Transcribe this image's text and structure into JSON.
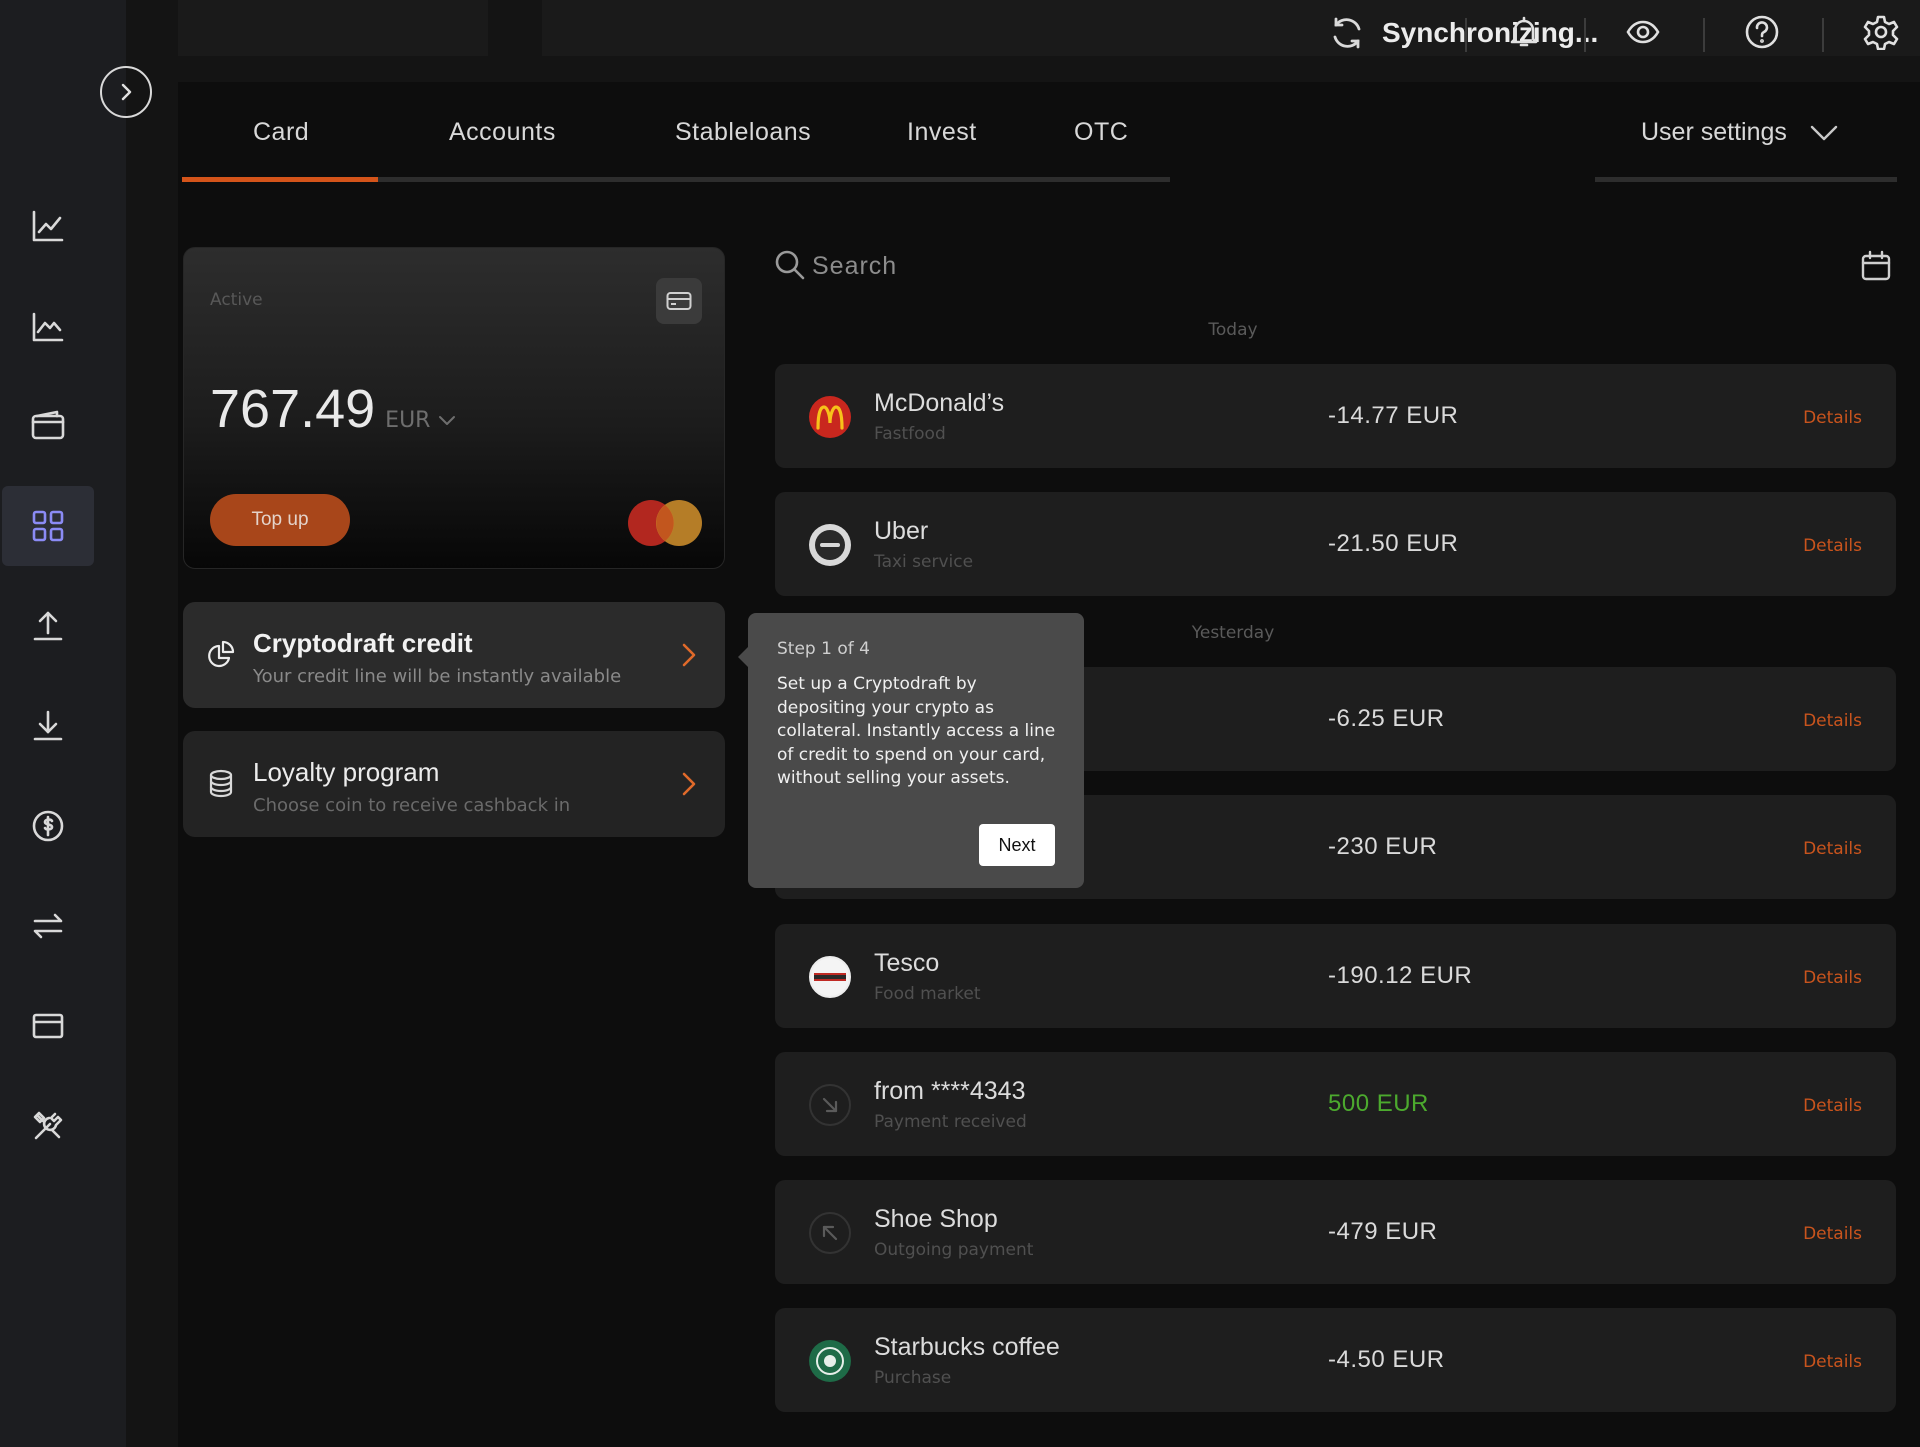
{
  "header": {
    "sync_status": "Synchronizing..."
  },
  "tabs": [
    {
      "label": "Card"
    },
    {
      "label": "Accounts"
    },
    {
      "label": "Stableloans"
    },
    {
      "label": "Invest"
    },
    {
      "label": "OTC"
    }
  ],
  "user_settings": {
    "label": "User settings"
  },
  "card": {
    "status": "Active",
    "balance": "767.49",
    "currency": "EUR",
    "topup_label": "Top up"
  },
  "features": [
    {
      "title": "Cryptodraft credit",
      "subtitle": "Your credit line will be instantly available"
    },
    {
      "title": "Loyalty program",
      "subtitle": "Choose coin to receive cashback in"
    }
  ],
  "search": {
    "placeholder": "Search"
  },
  "groups": {
    "today": "Today",
    "yesterday": "Yesterday"
  },
  "transactions": [
    {
      "name": "McDonald’s",
      "category": "Fastfood",
      "amount": "-14.77 EUR",
      "details": "Details"
    },
    {
      "name": "Uber",
      "category": "Taxi service",
      "amount": "-21.50 EUR",
      "details": "Details"
    },
    {
      "name": "",
      "category": "",
      "amount": "-6.25 EUR",
      "details": "Details"
    },
    {
      "name": "",
      "category": "",
      "amount": "-230 EUR",
      "details": "Details"
    },
    {
      "name": "Tesco",
      "category": "Food market",
      "amount": "-190.12 EUR",
      "details": "Details"
    },
    {
      "name": "from ****4343",
      "category": "Payment received",
      "amount": "500 EUR",
      "details": "Details"
    },
    {
      "name": "Shoe Shop",
      "category": "Outgoing payment",
      "amount": "-479 EUR",
      "details": "Details"
    },
    {
      "name": "Starbucks coffee",
      "category": "Purchase",
      "amount": "-4.50 EUR",
      "details": "Details"
    }
  ],
  "tooltip": {
    "step": "Step 1 of 4",
    "body": "Set up a Cryptodraft by depositing your crypto as collateral. Instantly access a line of credit to spend on your card, without selling your assets.",
    "next_label": "Next"
  },
  "colors": {
    "accent": "#d4541a",
    "details": "#c9541d",
    "positive": "#4caa2e",
    "active_nav": "#8b8bf5"
  },
  "icons": {
    "rail": [
      "chart-line-icon",
      "trending-chart-icon",
      "wallet-icon",
      "grid-icon",
      "upload-icon",
      "download-icon",
      "dollar-circle-icon",
      "exchange-icon",
      "card-icon",
      "tools-icon"
    ],
    "header": [
      "sync-icon",
      "bell-icon",
      "eye-icon",
      "help-icon",
      "gear-icon"
    ]
  }
}
